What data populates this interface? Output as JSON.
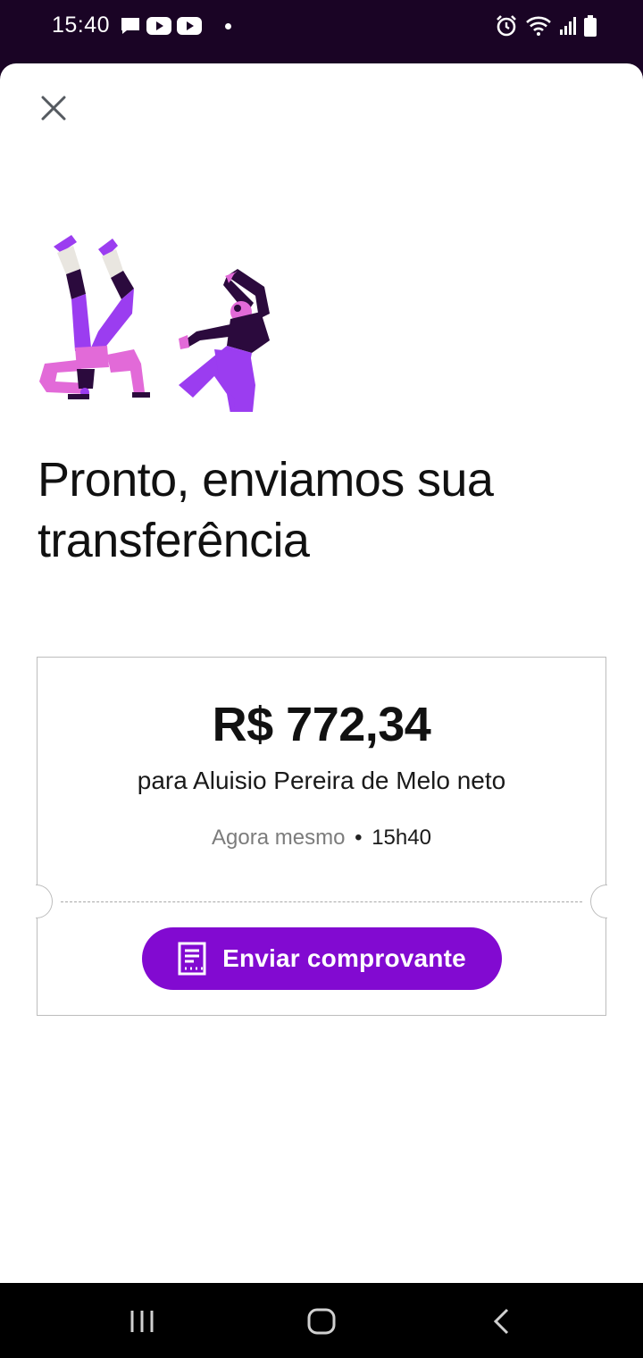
{
  "status_bar": {
    "time": "15:40",
    "left_icons": [
      "message-icon",
      "youtube-icon",
      "youtube-icon",
      "dot"
    ],
    "right_icons": [
      "alarm-icon",
      "wifi-icon",
      "signal-icon",
      "battery-icon"
    ]
  },
  "sheet": {
    "close_icon": "close-icon",
    "illustration": "dancing-people-illustration",
    "headline": "Pronto, enviamos sua transferência"
  },
  "receipt": {
    "amount": "R$ 772,34",
    "recipient": "para Aluisio Pereira de Melo neto",
    "when": "Agora mesmo",
    "separator": "•",
    "time": "15h40",
    "button": {
      "label": "Enviar comprovante",
      "icon": "receipt-icon"
    }
  },
  "nav_bar": {
    "buttons": [
      "recent-apps-icon",
      "home-icon",
      "back-icon"
    ]
  },
  "colors": {
    "status_bar_bg": "#1a0425",
    "accent": "#820ad1",
    "nav_bar_bg": "#000000"
  }
}
